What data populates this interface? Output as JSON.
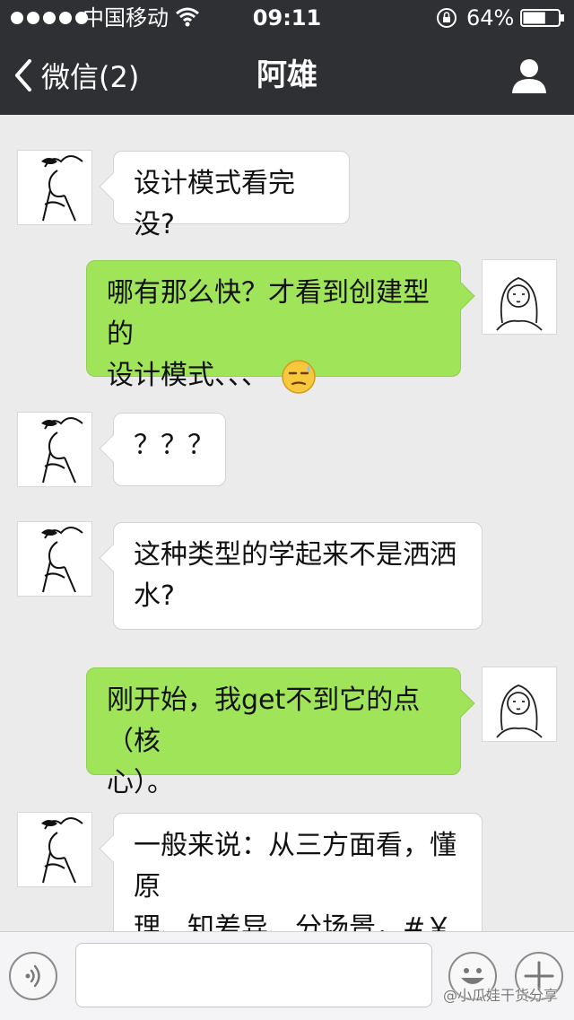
{
  "status_bar": {
    "carrier": "中国移动",
    "time": "09:11",
    "battery_percent": "64%",
    "battery_level": 0.64
  },
  "nav": {
    "back_label": "微信(2)",
    "title": "阿雄"
  },
  "messages": [
    {
      "side": "left",
      "text": "设计模式看完没?"
    },
    {
      "side": "right",
      "text": "哪有那么快？才看到创建型的\n设计模式、、、",
      "emoji": "sweat-smile-emoji"
    },
    {
      "side": "left",
      "text": "？？？"
    },
    {
      "side": "left",
      "text": "这种类型的学起来不是洒洒\n水?"
    },
    {
      "side": "right",
      "text": "刚开始，我get不到它的点（核\n心）。"
    },
    {
      "side": "left",
      "text": "一般来说：从三方面看，懂原\n理、知差异、分场景，#￥￥\n%&^%#%&........"
    }
  ],
  "input": {
    "value": "",
    "placeholder": ""
  },
  "watermark": "@小瓜娃干货分享",
  "colors": {
    "nav_bg": "#2e3033",
    "chat_bg": "#ebebeb",
    "sent_bubble": "#9fe459",
    "received_bubble": "#ffffff"
  }
}
